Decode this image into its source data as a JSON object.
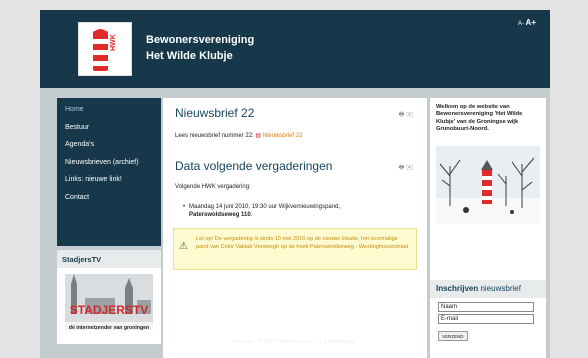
{
  "header": {
    "title_line1": "Bewonersvereniging",
    "title_line2": "Het Wilde Klubje",
    "logo_text": "HWK",
    "font_small": "A-",
    "font_large": "A+"
  },
  "nav": {
    "items": [
      {
        "label": "Home"
      },
      {
        "label": "Bestuur"
      },
      {
        "label": "Agenda's"
      },
      {
        "label": "Nieuwsbrieven (archief)"
      },
      {
        "label": "Links: nieuwe link!"
      },
      {
        "label": "Contact"
      }
    ]
  },
  "stadjers": {
    "heading": "StadjersTV",
    "logo_text": "STADJERSTV",
    "tagline": "dé internetzender van groningen"
  },
  "article1": {
    "title": "Nieuwsbrief 22",
    "lead": "Lees nieuwsbrief nummer 22:",
    "link": "Nieuwsbrief 22"
  },
  "article2": {
    "title": "Data volgende vergaderingen",
    "intro": "Volgende HWK vergadering:",
    "bullet_normal": "Maandag 14 juni 2010, 19:30 uur Wijkvernieuwingspand,",
    "bullet_bold": "Paterswoldseweg 110",
    "bullet_end": "."
  },
  "warning": {
    "text": "Let op! De vergadering is sinds 10 mei 2010 op de nieuwe lokatie, het voormalige pand van Color Vaktab Versteegh op de hoek Paterswoldseweg - Westinghousestraat"
  },
  "sidebar": {
    "welcome": "Welkom op de website van Bewonersvereniging 'Het Wilde Klubje' van de Groningse wijk Grunobuurt-Noord."
  },
  "newsletter": {
    "heading_bold": "Inschrijven",
    "heading_light": "nieuwsbrief",
    "name_placeholder": "Naam",
    "email_placeholder": "E-mail",
    "submit_label": "VERZEND"
  },
  "footer": {
    "text": "Website: 4PUNT4 OpenSource ICT & Webdesign"
  },
  "colors": {
    "header_bg": "#16384a",
    "page_bg": "#c4cccf",
    "link_orange": "#e07a10",
    "title_blue": "#17455c"
  }
}
